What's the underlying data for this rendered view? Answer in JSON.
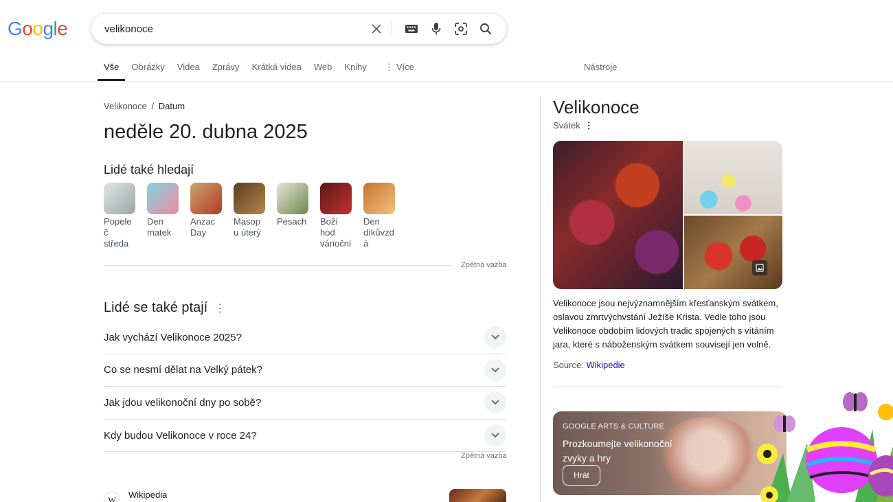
{
  "logo": {
    "letters": [
      "G",
      "o",
      "o",
      "g",
      "l",
      "e"
    ],
    "colors": [
      "#4285F4",
      "#EA4335",
      "#FBBC05",
      "#4285F4",
      "#34A853",
      "#EA4335"
    ]
  },
  "search": {
    "value": "velikonoce"
  },
  "tabs": [
    {
      "label": "Vše",
      "active": true
    },
    {
      "label": "Obrázky"
    },
    {
      "label": "Videa"
    },
    {
      "label": "Zprávy"
    },
    {
      "label": "Krátká videa"
    },
    {
      "label": "Web"
    },
    {
      "label": "Knihy"
    },
    {
      "label": "Více"
    }
  ],
  "tools_label": "Nástroje",
  "breadcrumb": {
    "parent": "Velikonoce",
    "sep": "/",
    "current": "Datum"
  },
  "answer": "neděle 20. dubna 2025",
  "people_also_search": {
    "title": "Lidé také hledají",
    "items": [
      {
        "label": "Popeleč středa",
        "colors": [
          "#dfe6ea",
          "#9aa8a0"
        ]
      },
      {
        "label": "Den matek",
        "colors": [
          "#7ed3df",
          "#f08aa2"
        ]
      },
      {
        "label": "Anzac Day",
        "colors": [
          "#c9a66b",
          "#b33a2a"
        ]
      },
      {
        "label": "Masopu úterý",
        "colors": [
          "#5a3e22",
          "#b8864a"
        ]
      },
      {
        "label": "Pesach",
        "colors": [
          "#e8e4d8",
          "#6a8a4a"
        ]
      },
      {
        "label": "Boží hod vánoční",
        "colors": [
          "#5a1a1a",
          "#c23030"
        ]
      },
      {
        "label": "Den díkůvzdá",
        "colors": [
          "#c8742e",
          "#f0c080"
        ]
      }
    ]
  },
  "feedback_label": "Zpětná vazba",
  "people_also_ask": {
    "title": "Lidé se také ptají",
    "questions": [
      "Jak vychází Velikonoce 2025?",
      "Co se nesmí dělat na Velký pátek?",
      "Jak jdou velikonoční dny po sobě?",
      "Kdy budou Velikonoce v roce 24?"
    ]
  },
  "wikipedia_result": {
    "source": "Wikipedia",
    "icon_letter": "W"
  },
  "knowledge_panel": {
    "title": "Velikonoce",
    "subtitle": "Svátek",
    "description": "Velikonoce jsou nejvýznamnějším křesťanským svátkem, oslavou zmrtvýchvstání Ježíše Krista. Vedle toho jsou Velikonoce obdobím lidových tradic spojených s vítáním jara, které s náboženským svátkem souvisejí jen volně.",
    "source_prefix": "Source:",
    "source_link": "Wikipedie"
  },
  "arts_culture_card": {
    "label": "GOOGLE ARTS & CULTURE",
    "text": "Prozkoumejte velikonoční zvyky a hry",
    "button": "Hrát"
  }
}
